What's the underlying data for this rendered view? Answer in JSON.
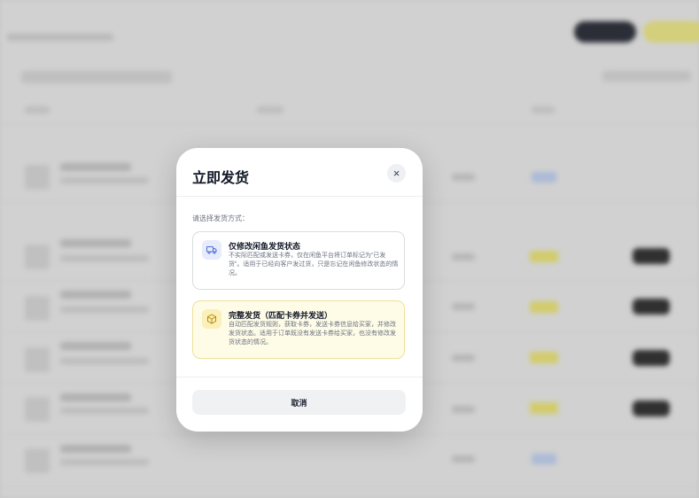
{
  "modal": {
    "title": "立即发货",
    "close_icon": "×",
    "prompt": "请选择发货方式：",
    "options": [
      {
        "icon": "truck-icon",
        "title": "仅修改闲鱼发货状态",
        "description": "不实际匹配或发送卡券，仅在闲鱼平台将订单标记为“已发货”。适用于已经向客户发过货，只是忘记在闲鱼修改状态的情况。"
      },
      {
        "icon": "package-icon",
        "title": "完整发货（匹配卡券并发送）",
        "description": "自动匹配发货规则，获取卡券，发送卡券信息给买家，并修改发货状态。适用于订单既没有发送卡券给买家，也没有修改发货状态的情况。"
      }
    ],
    "cancel_label": "取消"
  },
  "colors": {
    "accent_yellow": "#fefbe7",
    "accent_blue": "#e6ecfb"
  }
}
